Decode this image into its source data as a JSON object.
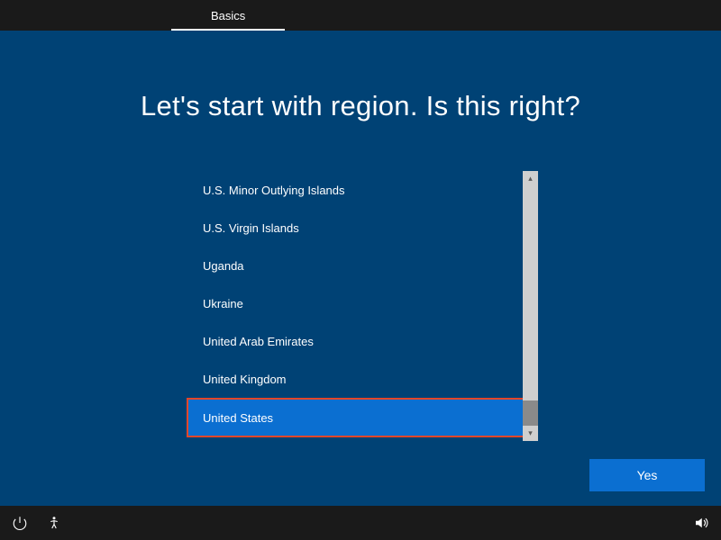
{
  "header": {
    "tab_label": "Basics"
  },
  "main": {
    "heading": "Let's start with region. Is this right?",
    "regions": [
      "U.S. Minor Outlying Islands",
      "U.S. Virgin Islands",
      "Uganda",
      "Ukraine",
      "United Arab Emirates",
      "United Kingdom",
      "United States"
    ],
    "selected_index": 6,
    "confirm_label": "Yes"
  }
}
